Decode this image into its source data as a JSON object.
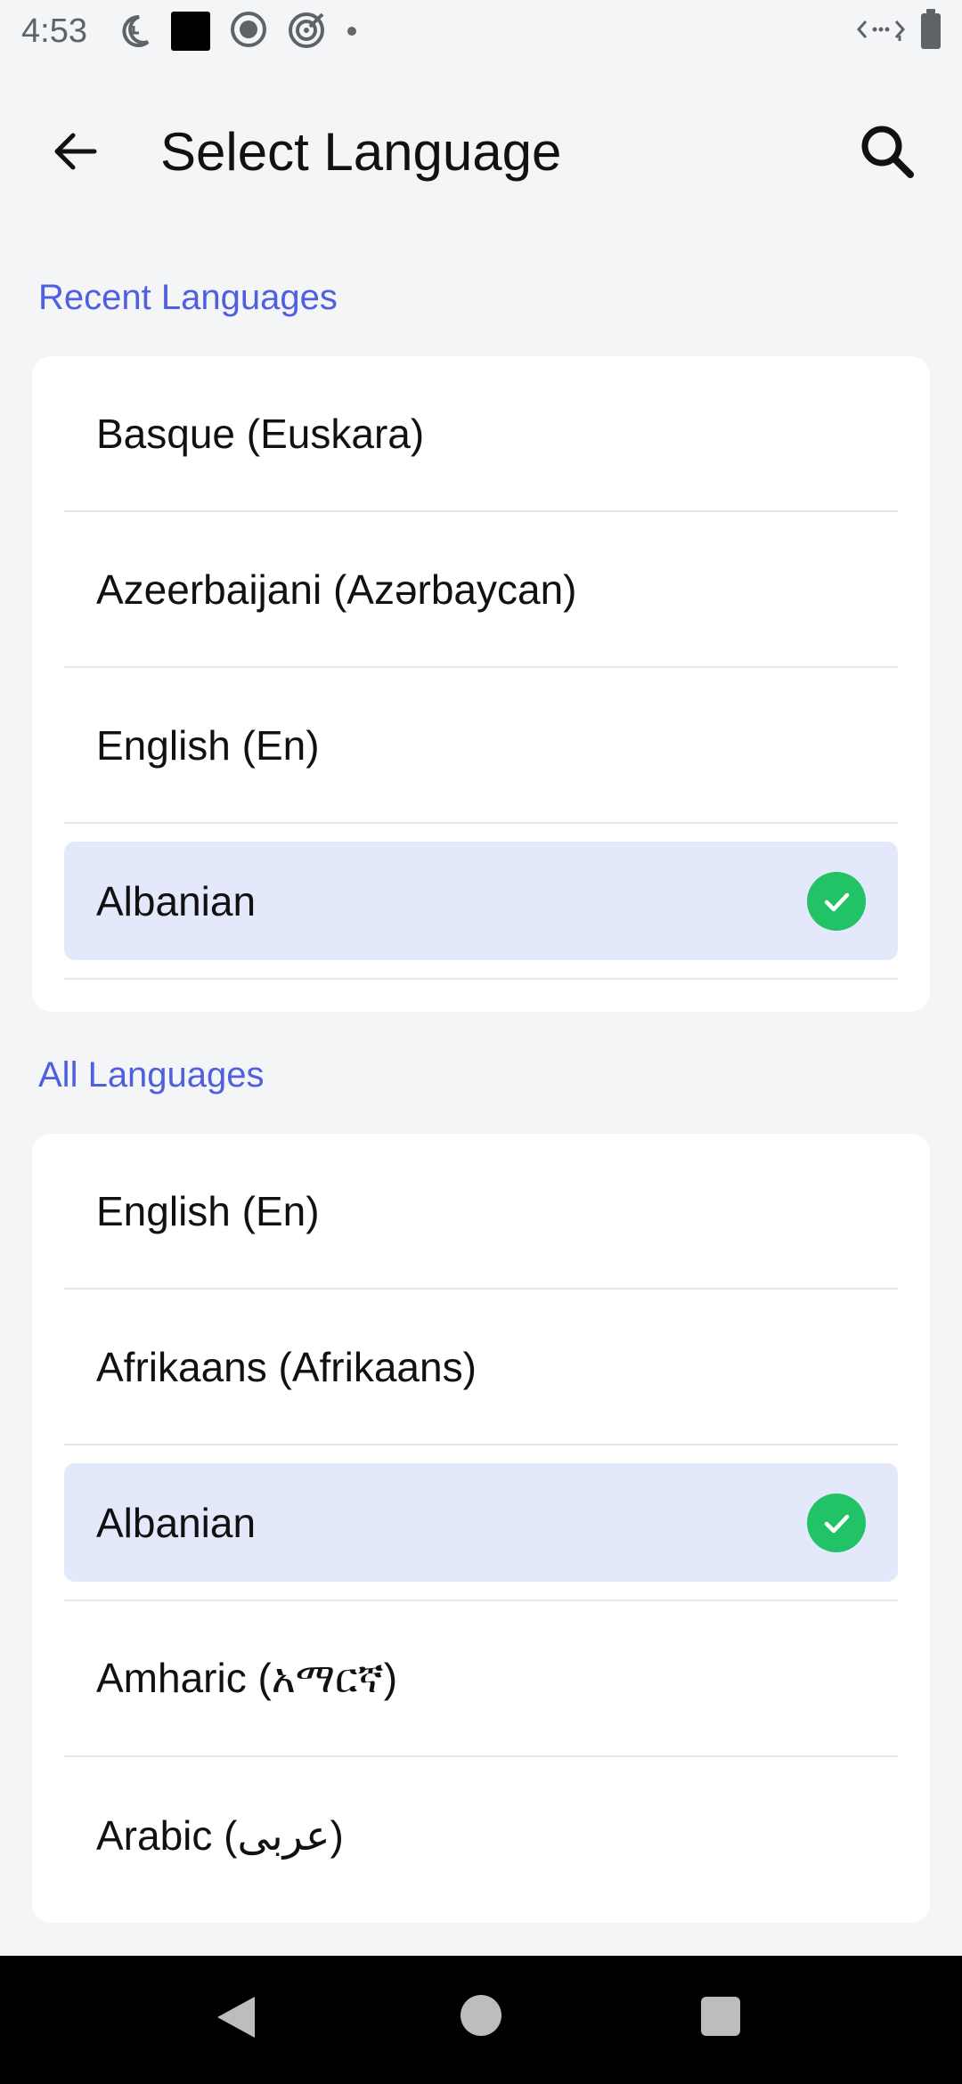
{
  "status_bar": {
    "time": "4:53"
  },
  "header": {
    "title": "Select Language",
    "back_icon": "arrow-left-icon",
    "search_icon": "search-icon"
  },
  "recent": {
    "heading": "Recent Languages",
    "items": [
      {
        "label": "Basque (Euskara)",
        "selected": false
      },
      {
        "label": "Azeerbaijani (Azərbaycan)",
        "selected": false
      },
      {
        "label": "English (En)",
        "selected": false
      },
      {
        "label": "Albanian",
        "selected": true
      }
    ]
  },
  "all": {
    "heading": "All Languages",
    "items": [
      {
        "label": "English (En)",
        "selected": false
      },
      {
        "label": "Afrikaans (Afrikaans)",
        "selected": false
      },
      {
        "label": "Albanian",
        "selected": true
      },
      {
        "label": "Amharic (አማርኛ)",
        "selected": false
      },
      {
        "label": "Arabic (عربى)",
        "selected": false
      }
    ]
  },
  "colors": {
    "accent": "#4f5fe0",
    "selected_bg": "#e3e8fb",
    "check_green": "#22c366"
  }
}
